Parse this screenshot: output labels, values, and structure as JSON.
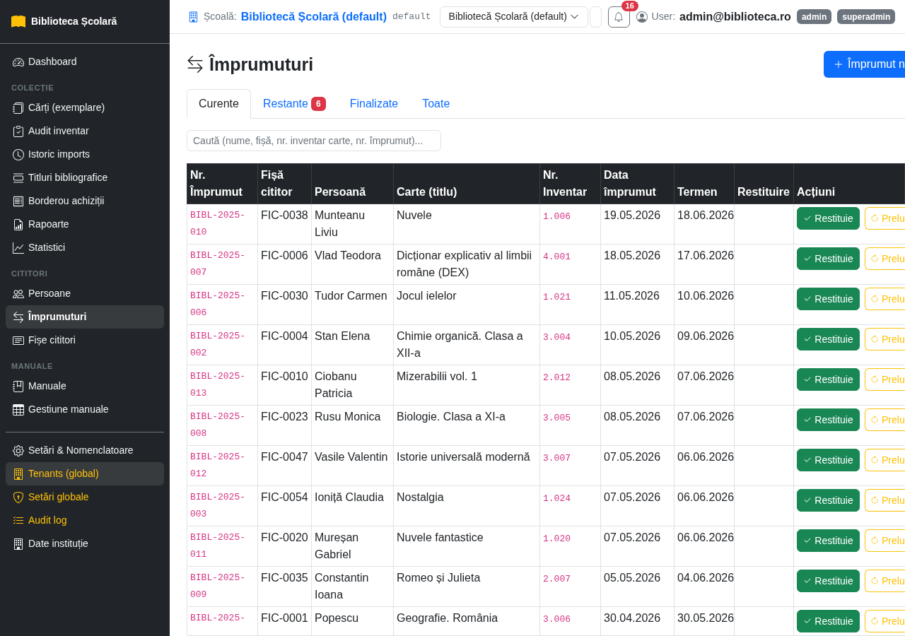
{
  "sidebar": {
    "brand": "Biblioteca Școlară",
    "sections": [
      {
        "items": [
          {
            "label": "Dashboard",
            "selected": false,
            "hovered": false
          }
        ]
      },
      {
        "heading": "COLECȚIE",
        "items": [
          {
            "label": "Cărți (exemplare)",
            "selected": false,
            "hovered": false
          },
          {
            "label": "Audit inventar",
            "selected": false,
            "hovered": false
          },
          {
            "label": "Istoric imports",
            "selected": false,
            "hovered": false
          },
          {
            "label": "Titluri bibliografice",
            "selected": false,
            "hovered": false
          },
          {
            "label": "Borderou achiziții",
            "selected": false,
            "hovered": false
          },
          {
            "label": "Rapoarte",
            "selected": false,
            "hovered": false
          },
          {
            "label": "Statistici",
            "selected": false,
            "hovered": false
          }
        ]
      },
      {
        "heading": "CITITORI",
        "items": [
          {
            "label": "Persoane",
            "selected": false,
            "hovered": false
          },
          {
            "label": "Împrumuturi",
            "selected": true,
            "hovered": false
          },
          {
            "label": "Fișe cititori",
            "selected": false,
            "hovered": false
          }
        ]
      },
      {
        "heading": "MANUALE",
        "items": [
          {
            "label": "Manuale",
            "selected": false,
            "hovered": false
          },
          {
            "label": "Gestiune manuale",
            "selected": false,
            "hovered": false
          }
        ]
      },
      {
        "items": [
          {
            "label": "Setări & Nomenclatoare",
            "kind": "standard",
            "selected": false,
            "hovered": false
          },
          {
            "label": "Tenants (global)",
            "kind": "global",
            "selected": false,
            "hovered": true
          },
          {
            "label": "Setări globale",
            "kind": "global",
            "selected": false,
            "hovered": false
          },
          {
            "label": "Audit log",
            "kind": "global",
            "selected": false,
            "hovered": false
          },
          {
            "label": "Date instituție",
            "kind": "standard",
            "selected": false,
            "hovered": false
          }
        ]
      }
    ]
  },
  "topbar": {
    "school_label": "Școală:",
    "school_name": "Bibliotecă Școlară (default)",
    "school_code": "default",
    "school_select": {
      "value": "Bibliotecă Școlară (default)"
    },
    "notifications_badge": "16",
    "user_label": "User:",
    "user_email": "admin@biblioteca.ro",
    "roles": [
      "admin",
      "superadmin"
    ]
  },
  "page": {
    "title": "Împrumuturi",
    "new_button": "Împrumut n"
  },
  "tabs": [
    {
      "label": "Curente",
      "selected": true
    },
    {
      "label": "Restante",
      "selected": false,
      "badge": "6"
    },
    {
      "label": "Finalizate",
      "selected": false
    },
    {
      "label": "Toate",
      "selected": false
    }
  ],
  "search": {
    "placeholder": "Caută (nume, fișă, nr. inventar carte, nr. împrumut)..."
  },
  "table": {
    "columns": [
      "Nr. Împrumut",
      "Fișă cititor",
      "Persoană",
      "Carte (titlu)",
      "Nr. Inventar",
      "Data împrumut",
      "Termen",
      "Restituire",
      "Acțiuni"
    ],
    "rows": [
      {
        "loan_no": "BIBL-2025-010",
        "card": "FIC-0038",
        "person": "Munteanu Liviu",
        "book": "Nuvele",
        "inventory": "1.006",
        "loan_date": "19.05.2026",
        "due": "18.06.2026",
        "actions": [
          {
            "kind": "return",
            "label": "Restituie"
          },
          {
            "kind": "renew",
            "label": "Prelu"
          }
        ]
      },
      {
        "loan_no": "BIBL-2025-007",
        "card": "FIC-0006",
        "person": "Vlad Teodora",
        "book": "Dicționar explicativ al limbii române (DEX)",
        "inventory": "4.001",
        "loan_date": "18.05.2026",
        "due": "17.06.2026",
        "actions": [
          {
            "kind": "return",
            "label": "Restituie"
          },
          {
            "kind": "renew",
            "label": "Prelu"
          }
        ]
      },
      {
        "loan_no": "BIBL-2025-006",
        "card": "FIC-0030",
        "person": "Tudor Carmen",
        "book": "Jocul ielelor",
        "inventory": "1.021",
        "loan_date": "11.05.2026",
        "due": "10.06.2026",
        "actions": [
          {
            "kind": "return",
            "label": "Restituie"
          },
          {
            "kind": "renew",
            "label": "Prelu"
          }
        ]
      },
      {
        "loan_no": "BIBL-2025-002",
        "card": "FIC-0004",
        "person": "Stan Elena",
        "book": "Chimie organică. Clasa a XII-a",
        "inventory": "3.004",
        "loan_date": "10.05.2026",
        "due": "09.06.2026",
        "actions": [
          {
            "kind": "return",
            "label": "Restituie"
          },
          {
            "kind": "renew",
            "label": "Prelu"
          }
        ]
      },
      {
        "loan_no": "BIBL-2025-013",
        "card": "FIC-0010",
        "person": "Ciobanu Patricia",
        "book": "Mizerabilii vol. 1",
        "inventory": "2.012",
        "loan_date": "08.05.2026",
        "due": "07.06.2026",
        "actions": [
          {
            "kind": "return",
            "label": "Restituie"
          },
          {
            "kind": "renew",
            "label": "Prelu"
          }
        ]
      },
      {
        "loan_no": "BIBL-2025-008",
        "card": "FIC-0023",
        "person": "Rusu Monica",
        "book": "Biologie. Clasa a XI-a",
        "inventory": "3.005",
        "loan_date": "08.05.2026",
        "due": "07.06.2026",
        "actions": [
          {
            "kind": "return",
            "label": "Restituie"
          },
          {
            "kind": "renew",
            "label": "Prelu"
          }
        ]
      },
      {
        "loan_no": "BIBL-2025-012",
        "card": "FIC-0047",
        "person": "Vasile Valentin",
        "book": "Istorie universală modernă",
        "inventory": "3.007",
        "loan_date": "07.05.2026",
        "due": "06.06.2026",
        "actions": [
          {
            "kind": "return",
            "label": "Restituie"
          },
          {
            "kind": "renew",
            "label": "Prelu"
          }
        ]
      },
      {
        "loan_no": "BIBL-2025-003",
        "card": "FIC-0054",
        "person": "Ioniță Claudia",
        "book": "Nostalgia",
        "inventory": "1.024",
        "loan_date": "07.05.2026",
        "due": "06.06.2026",
        "actions": [
          {
            "kind": "return",
            "label": "Restituie"
          },
          {
            "kind": "renew",
            "label": "Prelu"
          }
        ]
      },
      {
        "loan_no": "BIBL-2025-011",
        "card": "FIC-0020",
        "person": "Mureșan Gabriel",
        "book": "Nuvele fantastice",
        "inventory": "1.020",
        "loan_date": "07.05.2026",
        "due": "06.06.2026",
        "actions": [
          {
            "kind": "return",
            "label": "Restituie"
          },
          {
            "kind": "renew",
            "label": "Prelu"
          }
        ]
      },
      {
        "loan_no": "BIBL-2025-009",
        "card": "FIC-0035",
        "person": "Constantin Ioana",
        "book": "Romeo și Julieta",
        "inventory": "2.007",
        "loan_date": "05.05.2026",
        "due": "04.06.2026",
        "actions": [
          {
            "kind": "return",
            "label": "Restituie"
          },
          {
            "kind": "renew",
            "label": "Prelu"
          }
        ]
      },
      {
        "loan_no": "BIBL-2025-",
        "card": "FIC-0001",
        "person": "Popescu",
        "book": "Geografie. România",
        "inventory": "3.006",
        "loan_date": "30.04.2026",
        "due": "30.05.2026",
        "actions": [
          {
            "kind": "return",
            "label": "Restituie"
          },
          {
            "kind": "renew",
            "label": "Prelu"
          }
        ]
      }
    ]
  }
}
